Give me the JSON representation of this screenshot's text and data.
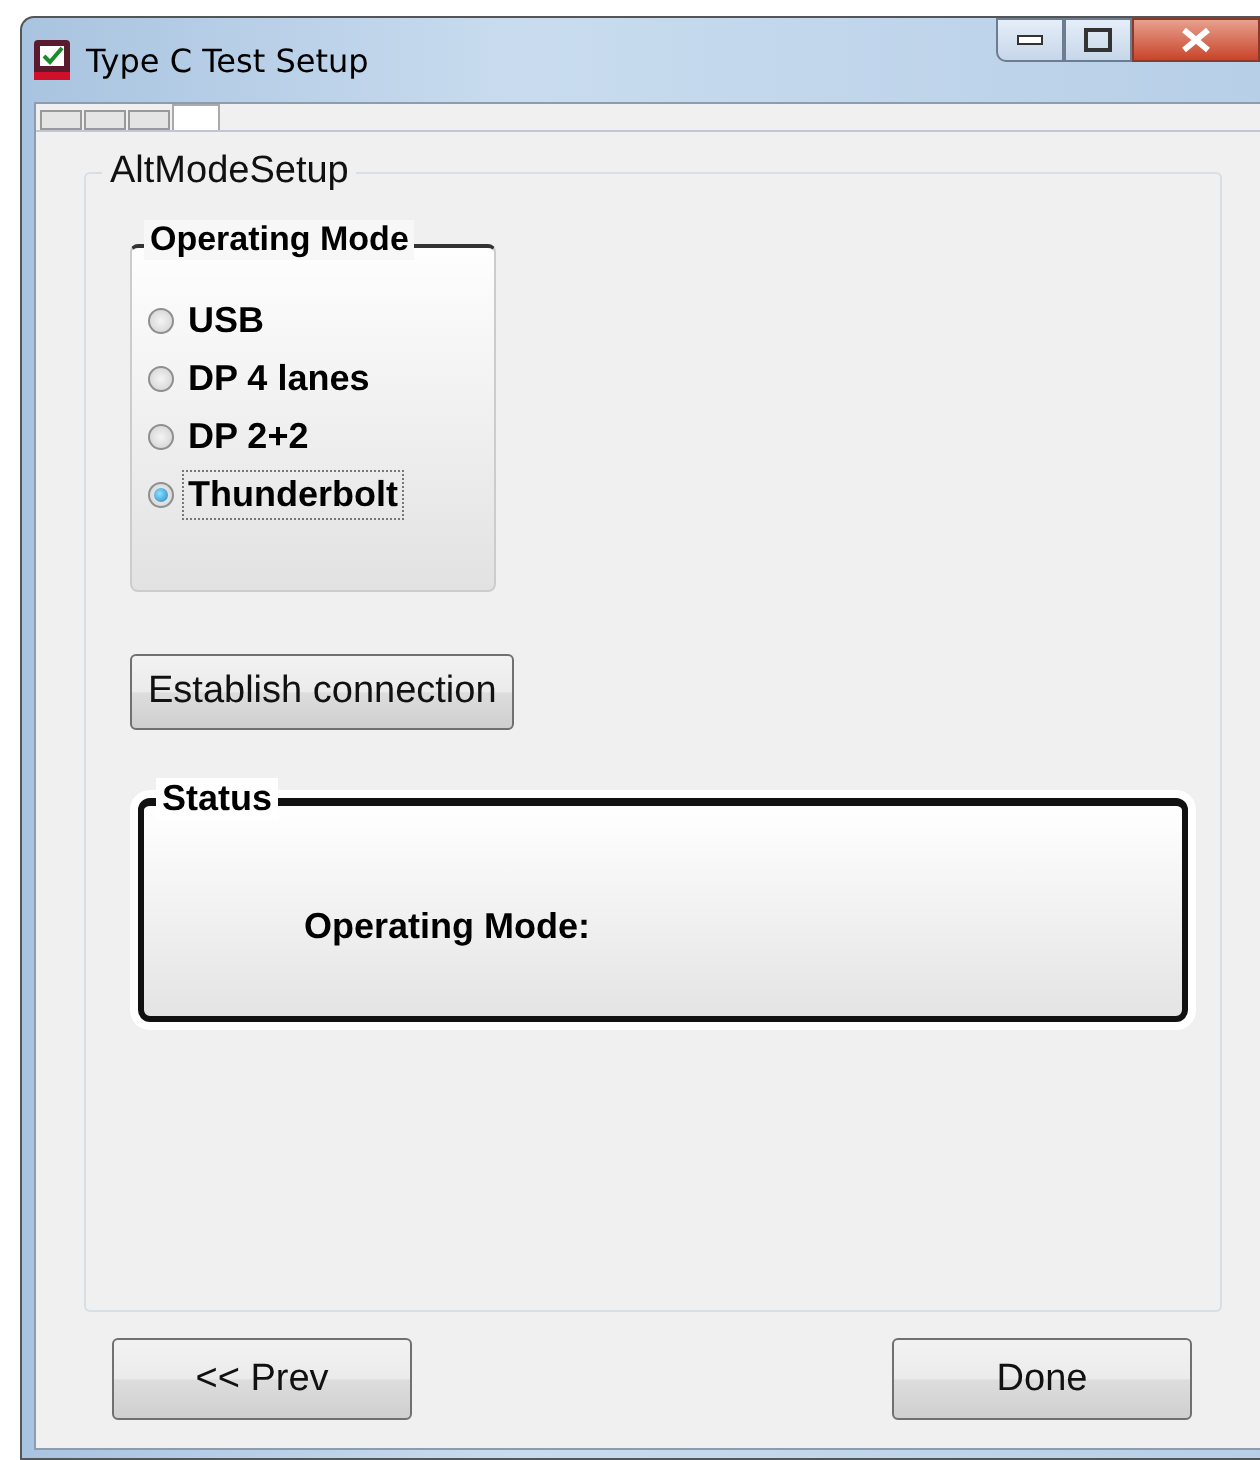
{
  "window": {
    "title": "Type C Test Setup"
  },
  "tabs": [
    {
      "selected": false
    },
    {
      "selected": false
    },
    {
      "selected": false
    },
    {
      "selected": true
    }
  ],
  "group": {
    "title": "AltModeSetup"
  },
  "operating_mode": {
    "title": "Operating Mode",
    "options": [
      {
        "label": "USB",
        "selected": false
      },
      {
        "label": "DP 4 lanes",
        "selected": false
      },
      {
        "label": "DP 2+2",
        "selected": false
      },
      {
        "label": "Thunderbolt",
        "selected": true
      }
    ]
  },
  "establish_button": "Establish connection",
  "status": {
    "title": "Status",
    "label": "Operating Mode:"
  },
  "buttons": [
    {
      "label": "<< Prev"
    },
    {
      "label": "Done"
    }
  ]
}
